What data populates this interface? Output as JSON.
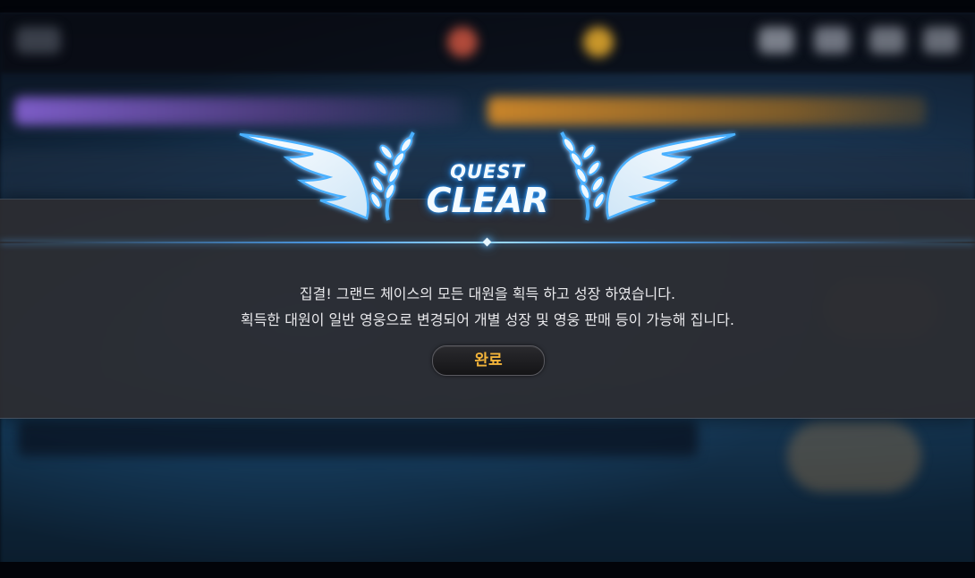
{
  "popup": {
    "badge_line1": "QUEST",
    "badge_line2": "CLEAR",
    "message_line1": "집결! 그랜드 체이스의 모든 대원을 획득 하고 성장 하였습니다.",
    "message_line2": "획득한 대원이 일반 영웅으로 변경되어 개별 성장 및 영웅 판매 등이 가능해 집니다.",
    "confirm_label": "완료"
  },
  "icons": {
    "wing_left": "wing-laurel-icon",
    "wing_right": "wing-laurel-icon"
  },
  "colors": {
    "badge_glow": "#3fa8ff",
    "button_text": "#f3b43a",
    "band_background": "#2c2c30",
    "accent_line": "#50aaff"
  }
}
